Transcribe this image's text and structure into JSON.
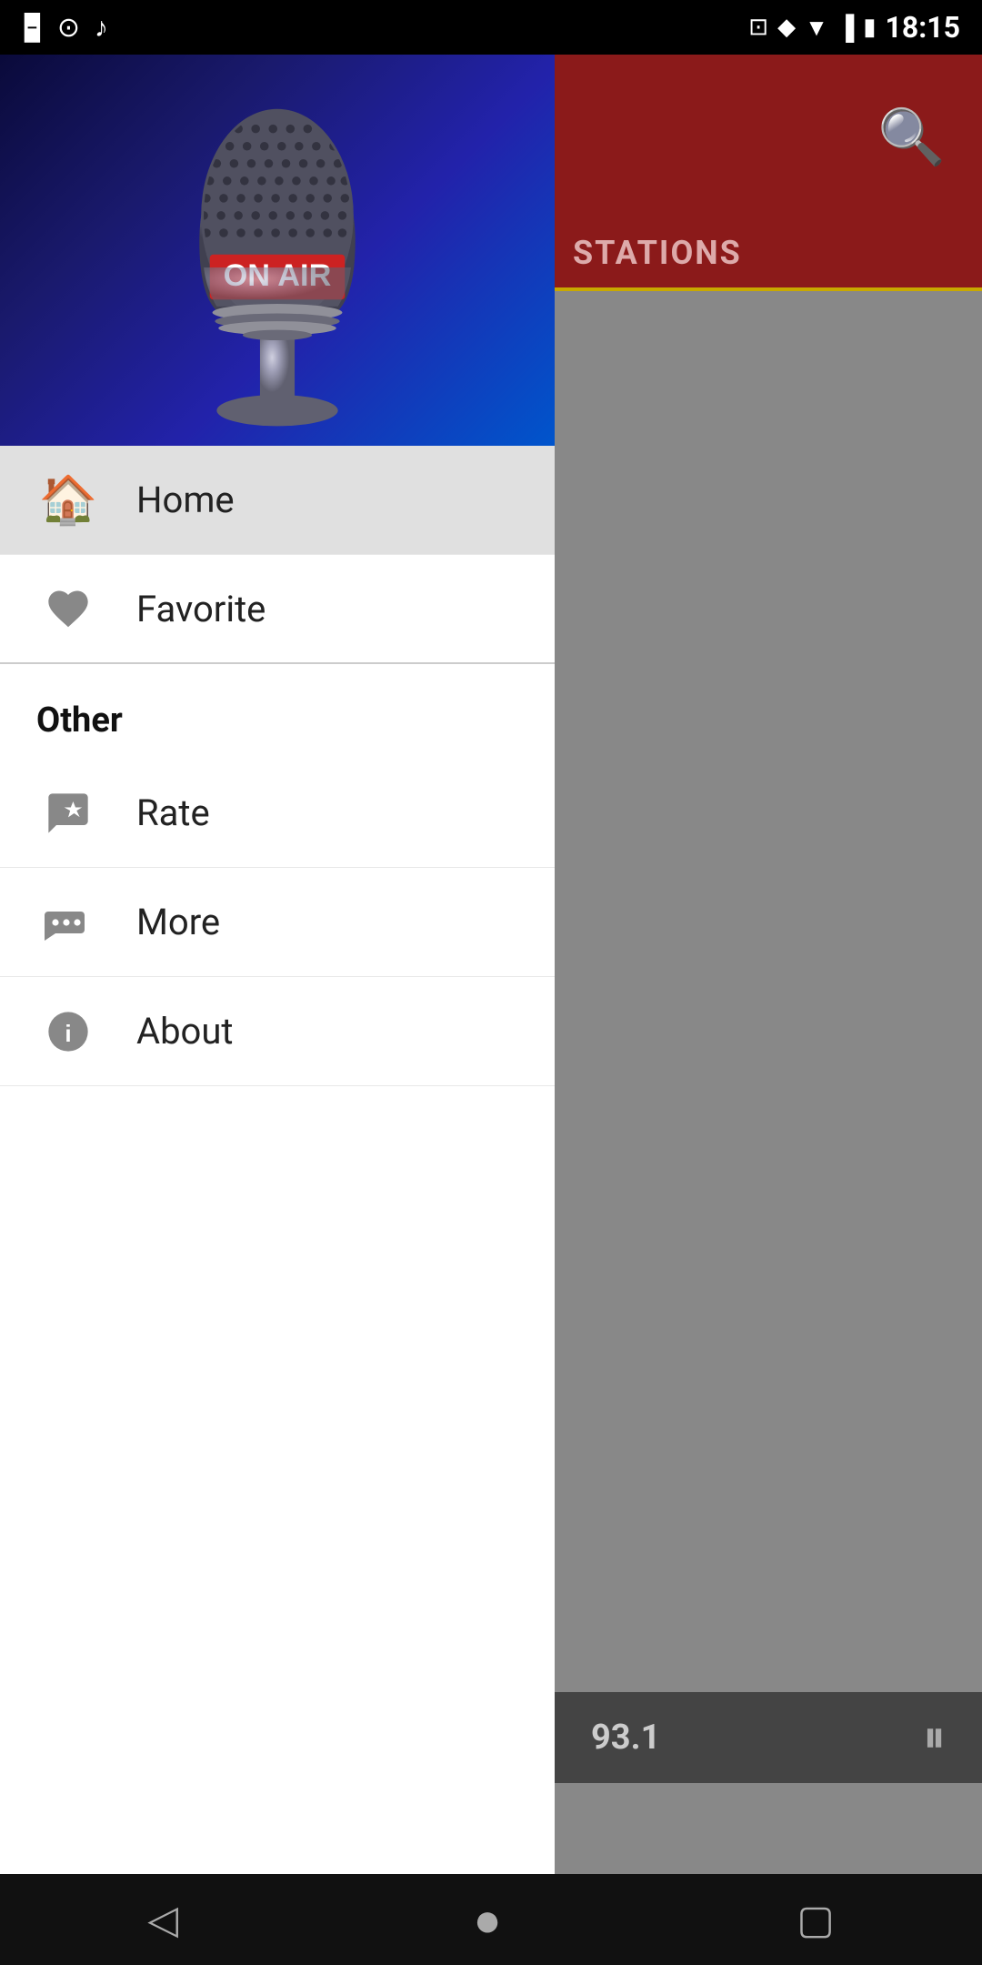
{
  "statusBar": {
    "time": "18:15",
    "icons": [
      "user-icon",
      "camera-icon",
      "music-icon",
      "cast-icon",
      "arrow-icon",
      "wifi-icon",
      "signal-icon",
      "battery-icon"
    ]
  },
  "drawer": {
    "headerAlt": "On Air Microphone",
    "navItems": [
      {
        "id": "home",
        "label": "Home",
        "icon": "home-icon",
        "active": true
      },
      {
        "id": "favorite",
        "label": "Favorite",
        "icon": "heart-icon",
        "active": false
      }
    ],
    "sectionHeader": "Other",
    "otherItems": [
      {
        "id": "rate",
        "label": "Rate",
        "icon": "rate-icon"
      },
      {
        "id": "more",
        "label": "More",
        "icon": "more-icon"
      },
      {
        "id": "about",
        "label": "About",
        "icon": "info-icon"
      }
    ]
  },
  "rightPanel": {
    "stationsLabel": "STATIONS",
    "playerStation": "93.1",
    "pauseLabel": "⏸"
  },
  "bottomNav": {
    "back": "◁",
    "home": "●",
    "recent": "▢"
  }
}
